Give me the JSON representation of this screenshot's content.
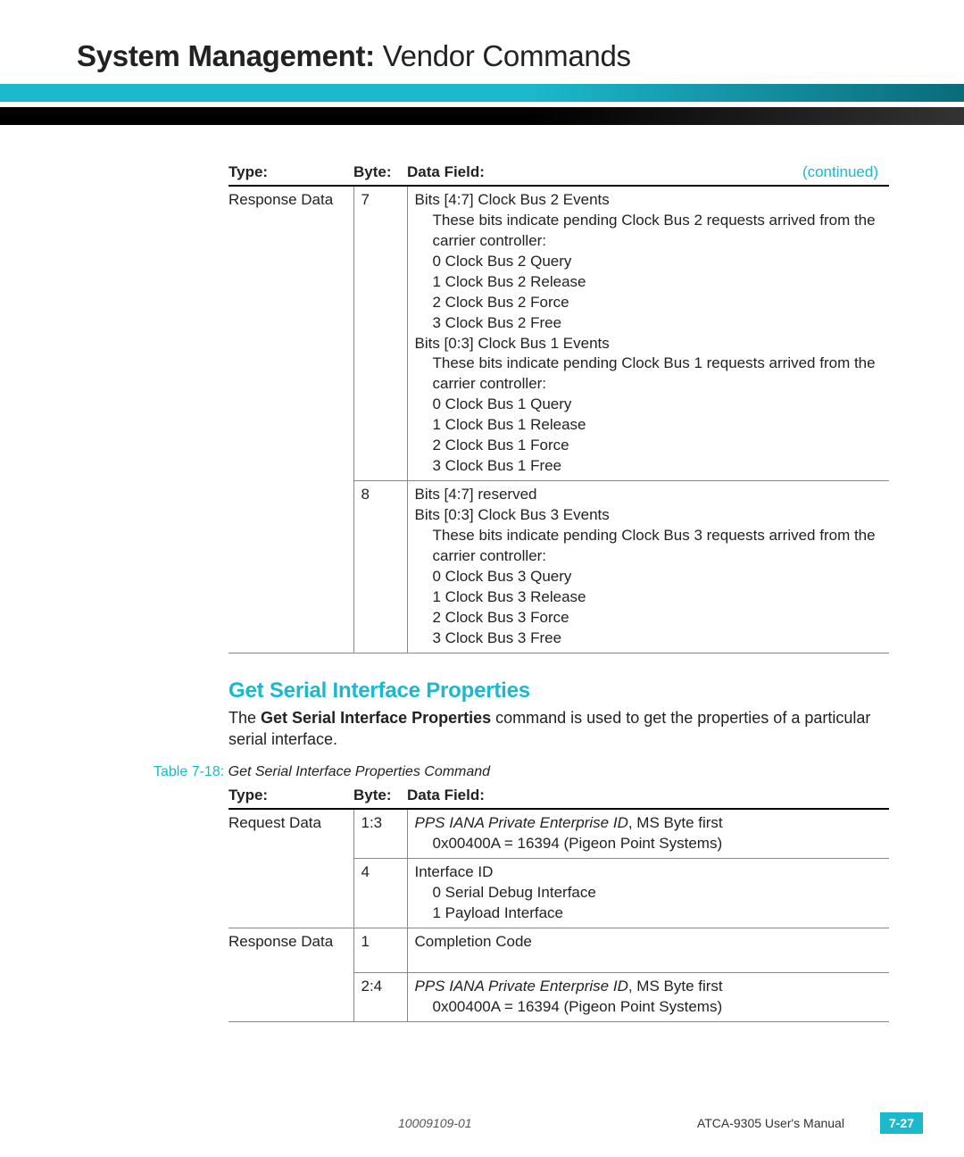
{
  "header": {
    "bold": "System Management:",
    "light": "  Vendor Commands"
  },
  "table1": {
    "headers": {
      "type": "Type:",
      "byte": "Byte:",
      "data": "Data Field:"
    },
    "continued": "(continued)",
    "rows": [
      {
        "type": "Response Data",
        "byte": "7",
        "data": {
          "line1": "Bits [4:7] Clock Bus 2 Events",
          "line2": "These bits indicate pending Clock Bus 2 requests arrived from the carrier controller:",
          "b0": "0   Clock Bus 2 Query",
          "b1": "1   Clock Bus 2 Release",
          "b2": "2   Clock Bus 2 Force",
          "b3": "3   Clock Bus 2 Free",
          "line3": "Bits [0:3] Clock Bus 1 Events",
          "line4": "These bits indicate pending Clock Bus 1 requests arrived from the carrier controller:",
          "c0": "0   Clock Bus 1 Query",
          "c1": "1   Clock Bus 1 Release",
          "c2": "2   Clock Bus 1 Force",
          "c3": "3   Clock Bus 1 Free"
        }
      },
      {
        "type": "",
        "byte": "8",
        "data": {
          "line1": "Bits [4:7] reserved",
          "line2": "Bits [0:3] Clock Bus 3 Events",
          "line3": "These bits indicate pending Clock Bus 3 requests arrived from the carrier controller:",
          "d0": "0   Clock Bus 3 Query",
          "d1": "1   Clock Bus 3 Release",
          "d2": "2   Clock Bus 3 Force",
          "d3": "3   Clock Bus 3 Free"
        }
      }
    ]
  },
  "section": {
    "title": "Get Serial Interface Properties",
    "para_pre": "The ",
    "para_bold": "Get Serial Interface Properties",
    "para_post": " command is used to get the properties of a particular serial interface."
  },
  "caption": {
    "num": "Table 7-18:",
    "txt": "  Get Serial Interface Properties Command"
  },
  "table2": {
    "headers": {
      "type": "Type:",
      "byte": "Byte:",
      "data": "Data Field:"
    },
    "rows": [
      {
        "type": "Request Data",
        "byte": "1:3",
        "data": {
          "italic": "PPS IANA Private Enterprise ID",
          "rest": ", MS Byte first",
          "sub": "0x00400A = 16394 (Pigeon Point Systems)"
        }
      },
      {
        "type": "",
        "byte": "4",
        "data": {
          "line": "Interface ID",
          "i0": "0   Serial Debug Interface",
          "i1": "1   Payload Interface"
        }
      },
      {
        "type": "Response Data",
        "byte": "1",
        "data": {
          "line": "Completion Code"
        }
      },
      {
        "type": "",
        "byte": "2:4",
        "data": {
          "italic": "PPS IANA Private Enterprise ID",
          "rest": ", MS Byte first",
          "sub": "0x00400A = 16394 (Pigeon Point Systems)"
        }
      }
    ]
  },
  "footer": {
    "docnum": "10009109-01",
    "manual": "ATCA-9305 User's Manual",
    "pagenum": "7-27"
  }
}
